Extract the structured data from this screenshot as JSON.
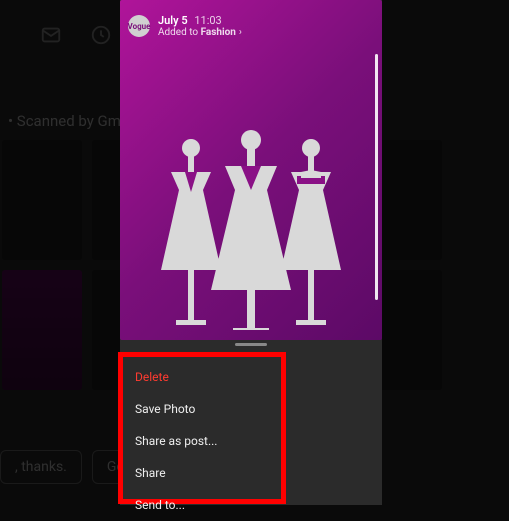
{
  "background": {
    "scanned_label": "•  Scanned by Gm",
    "chips": {
      "thanks": ", thanks.",
      "go": "Go"
    }
  },
  "story": {
    "date": "July 5",
    "time": "11:03",
    "added_prefix": "Added to ",
    "collection": "Fashion",
    "chevron": "›",
    "avatar_text": "Vogue"
  },
  "menu": {
    "delete": "Delete",
    "save_photo": "Save Photo",
    "share_as_post": "Share as post...",
    "share": "Share",
    "send_to": "Send to..."
  },
  "highlight_color": "#ff0000"
}
